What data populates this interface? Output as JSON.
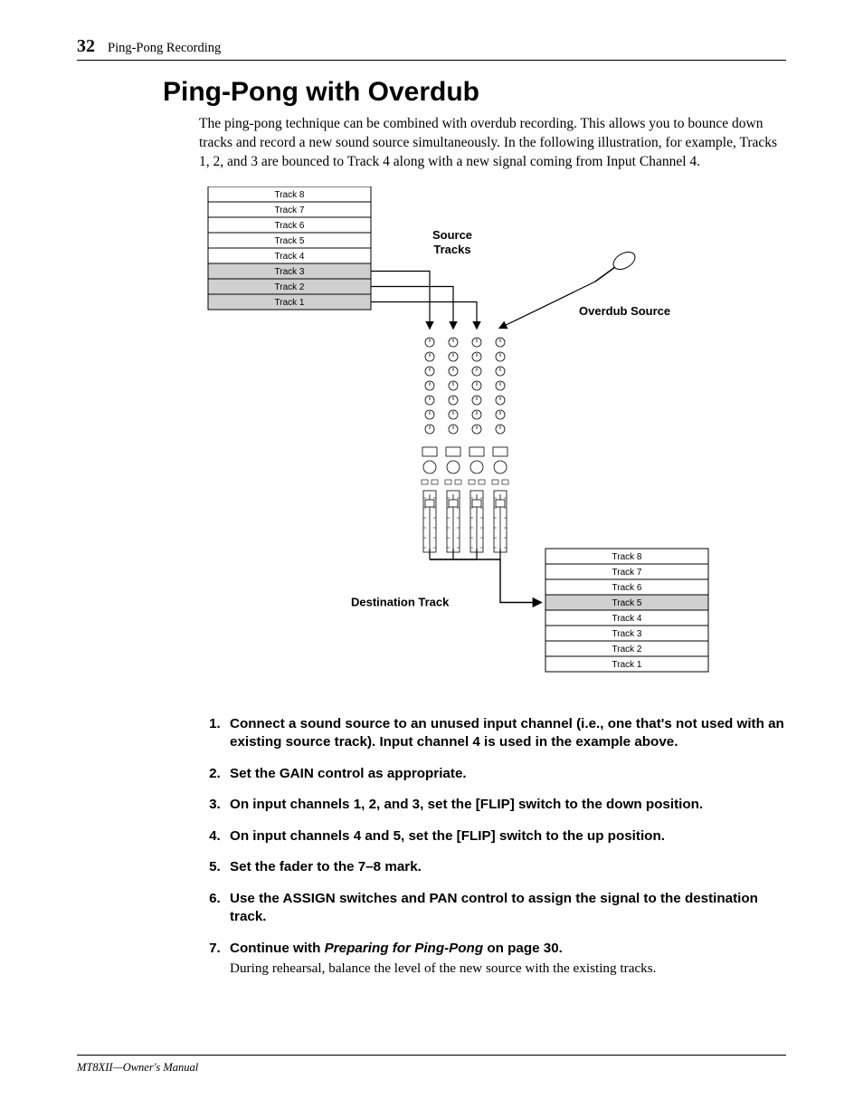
{
  "header": {
    "page_number": "32",
    "chapter": "Ping-Pong Recording"
  },
  "section_title": "Ping-Pong with Overdub",
  "intro": "The ping-pong technique can be combined with overdub recording. This allows you to bounce down tracks and record a new sound source simultaneously. In the following illustration, for example, Tracks 1, 2, and 3 are bounced to Track 4 along with a new signal coming from Input Channel 4.",
  "diagram": {
    "left_tracks": [
      "Track 8",
      "Track 7",
      "Track 6",
      "Track 5",
      "Track 4",
      "Track 3",
      "Track 2",
      "Track 1"
    ],
    "left_shaded_indices": [
      5,
      6,
      7
    ],
    "right_tracks": [
      "Track 8",
      "Track 7",
      "Track 6",
      "Track 5",
      "Track 4",
      "Track 3",
      "Track 2",
      "Track 1"
    ],
    "right_shaded_indices": [
      3
    ],
    "labels": {
      "source": "Source\nTracks",
      "overdub": "Overdub Source",
      "destination": "Destination Track"
    }
  },
  "steps": [
    {
      "text": "Connect a sound source to an unused input channel (i.e., one that's not used with an existing source track). Input channel 4 is used in the example above."
    },
    {
      "text": "Set the GAIN control as appropriate."
    },
    {
      "text": "On input channels 1, 2, and 3, set the [FLIP] switch to the down position."
    },
    {
      "text": "On input channels 4 and 5, set the [FLIP] switch to the up position."
    },
    {
      "text": "Set the fader to the 7–8 mark."
    },
    {
      "text": "Use the ASSIGN switches and PAN control to assign the signal to the destination track."
    },
    {
      "text_before": "Continue with ",
      "xref": "Preparing for Ping-Pong",
      "text_after": " on page 30.",
      "note": "During rehearsal, balance the level of the new source with the existing tracks."
    }
  ],
  "footer": "MT8XII—Owner's Manual"
}
